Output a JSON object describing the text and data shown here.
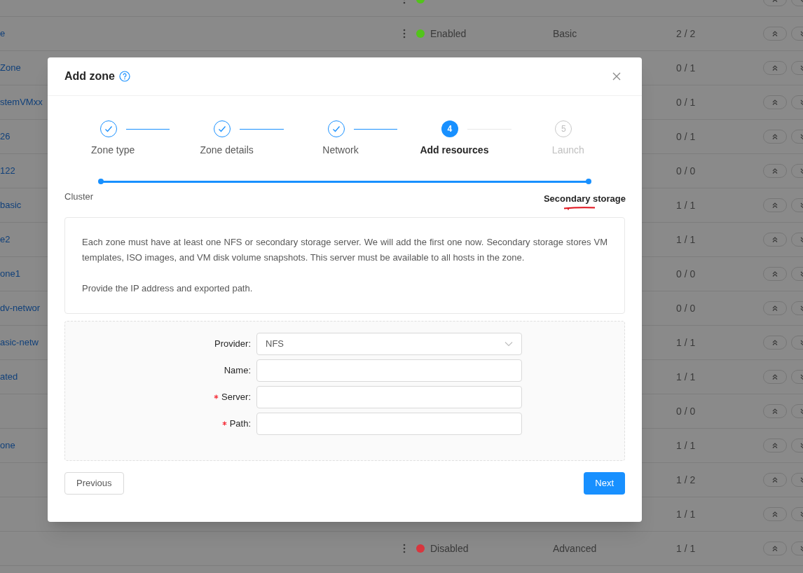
{
  "table": {
    "rows": [
      {
        "name": "",
        "status": {
          "color": "#52c41a"
        }
      },
      {
        "name": "e",
        "status": {
          "label": "Enabled",
          "color": "#52c41a"
        },
        "type": "Basic",
        "count": "2 / 2"
      },
      {
        "name": "Zone",
        "count": "0 / 1"
      },
      {
        "name": "stemVMxx",
        "count": "0 / 1"
      },
      {
        "name": "26",
        "count": "0 / 1"
      },
      {
        "name": "122",
        "count": "0 / 0"
      },
      {
        "name": "basic",
        "count": "1 / 1"
      },
      {
        "name": "e2",
        "count": "1 / 1"
      },
      {
        "name": "one1",
        "count": "0 / 0"
      },
      {
        "name": "dv-networ",
        "count": "0 / 0"
      },
      {
        "name": "asic-netw",
        "count": "1 / 1"
      },
      {
        "name": "ated",
        "count": "1 / 1"
      },
      {
        "name": "",
        "count": "0 / 0"
      },
      {
        "name": "one",
        "count": "1 / 1"
      },
      {
        "name": "",
        "count": "1 / 2"
      },
      {
        "name": "",
        "count": "1 / 1"
      },
      {
        "name": "",
        "status": {
          "label": "Disabled",
          "color": "#d9363e"
        },
        "type": "Advanced",
        "count": "1 / 1"
      }
    ]
  },
  "modal": {
    "title": "Add zone",
    "steps": [
      {
        "label": "Zone type",
        "done": true,
        "selected": false
      },
      {
        "label": "Zone details",
        "done": true,
        "selected": false
      },
      {
        "label": "Network",
        "done": true,
        "selected": false
      },
      {
        "label": "Add resources",
        "number": "4",
        "done": false,
        "selected": true
      },
      {
        "label": "Launch",
        "number": "5",
        "done": false,
        "selected": false
      }
    ],
    "substeps": [
      {
        "label": "Cluster",
        "selected": false,
        "underlined": false
      },
      {
        "label": "Secondary storage",
        "selected": true,
        "underlined": true
      }
    ],
    "description": [
      "Each zone must have at least one NFS or secondary storage server. We will add the first one now. Secondary storage stores VM templates, ISO images, and VM disk volume snapshots. This server must be available to all hosts in the zone.",
      "Provide the IP address and exported path."
    ],
    "fields": [
      {
        "label": "Provider:",
        "kind": "select",
        "value": "NFS",
        "required": false
      },
      {
        "label": "Name:",
        "kind": "input",
        "required": false
      },
      {
        "label": "Server:",
        "kind": "input",
        "required": true
      },
      {
        "label": "Path:",
        "kind": "input",
        "required": true
      }
    ],
    "buttons": {
      "previous": "Previous",
      "next": "Next"
    }
  }
}
